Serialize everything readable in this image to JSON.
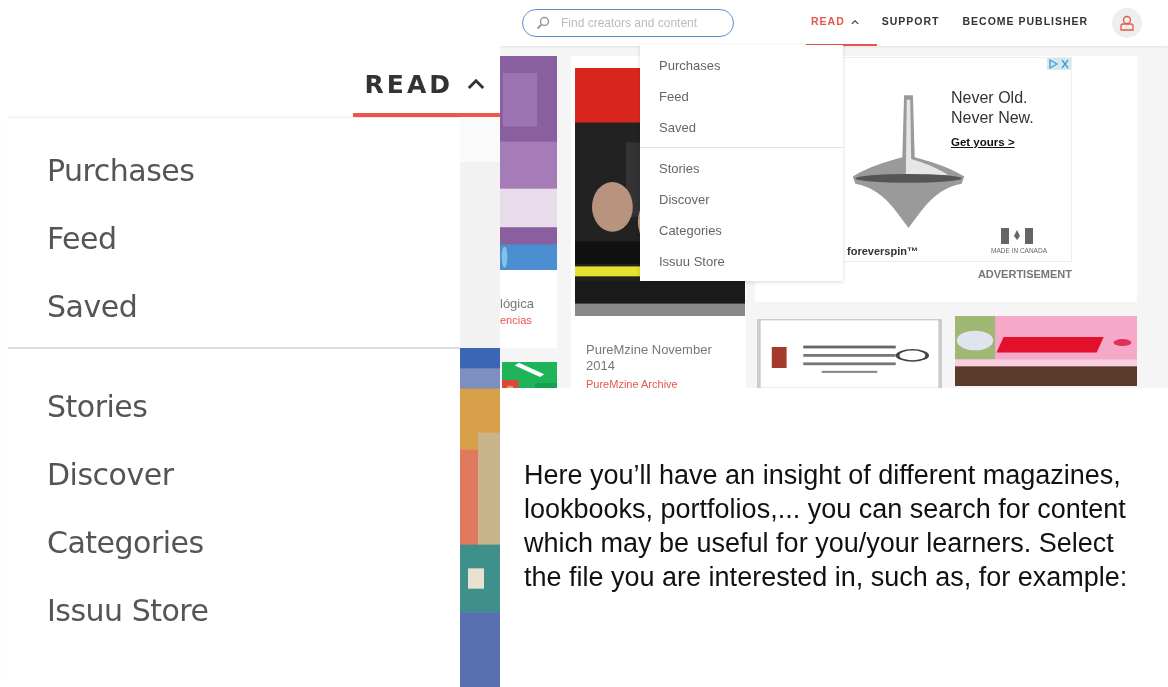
{
  "zoomed_menu": {
    "nav_item": {
      "label": "READ",
      "selected": true
    },
    "groups": [
      [
        "Purchases",
        "Feed",
        "Saved"
      ],
      [
        "Stories",
        "Discover",
        "Categories",
        "Issuu Store"
      ]
    ]
  },
  "screenshot": {
    "search": {
      "placeholder": "Find creators and content"
    },
    "nav": [
      {
        "label": "READ",
        "selected": true
      },
      {
        "label": "SUPPORT",
        "selected": false
      },
      {
        "label": "BECOME PUBLISHER",
        "selected": false
      }
    ],
    "menu_groups": [
      [
        "Purchases",
        "Feed",
        "Saved"
      ],
      [
        "Stories",
        "Discover",
        "Categories",
        "Issuu Store"
      ]
    ],
    "cards": [
      {
        "title": "lógica",
        "subtitle": "encias"
      },
      {
        "title": "PureMzine November 2014",
        "subtitle": "PureMzine Archive"
      }
    ],
    "ad": {
      "headline": [
        "Never Old.",
        "Never New."
      ],
      "link": "Get yours >",
      "brand": "foreverspin™",
      "origin": "MADE IN CANADA",
      "label": "ADVERTISEMENT"
    }
  },
  "paragraph": "Here you’ll have an insight of different magazines, lookbooks, portfolios,... you can search for content which may be useful for you/your learners. Select the file you are interested in, such as, for example:"
}
